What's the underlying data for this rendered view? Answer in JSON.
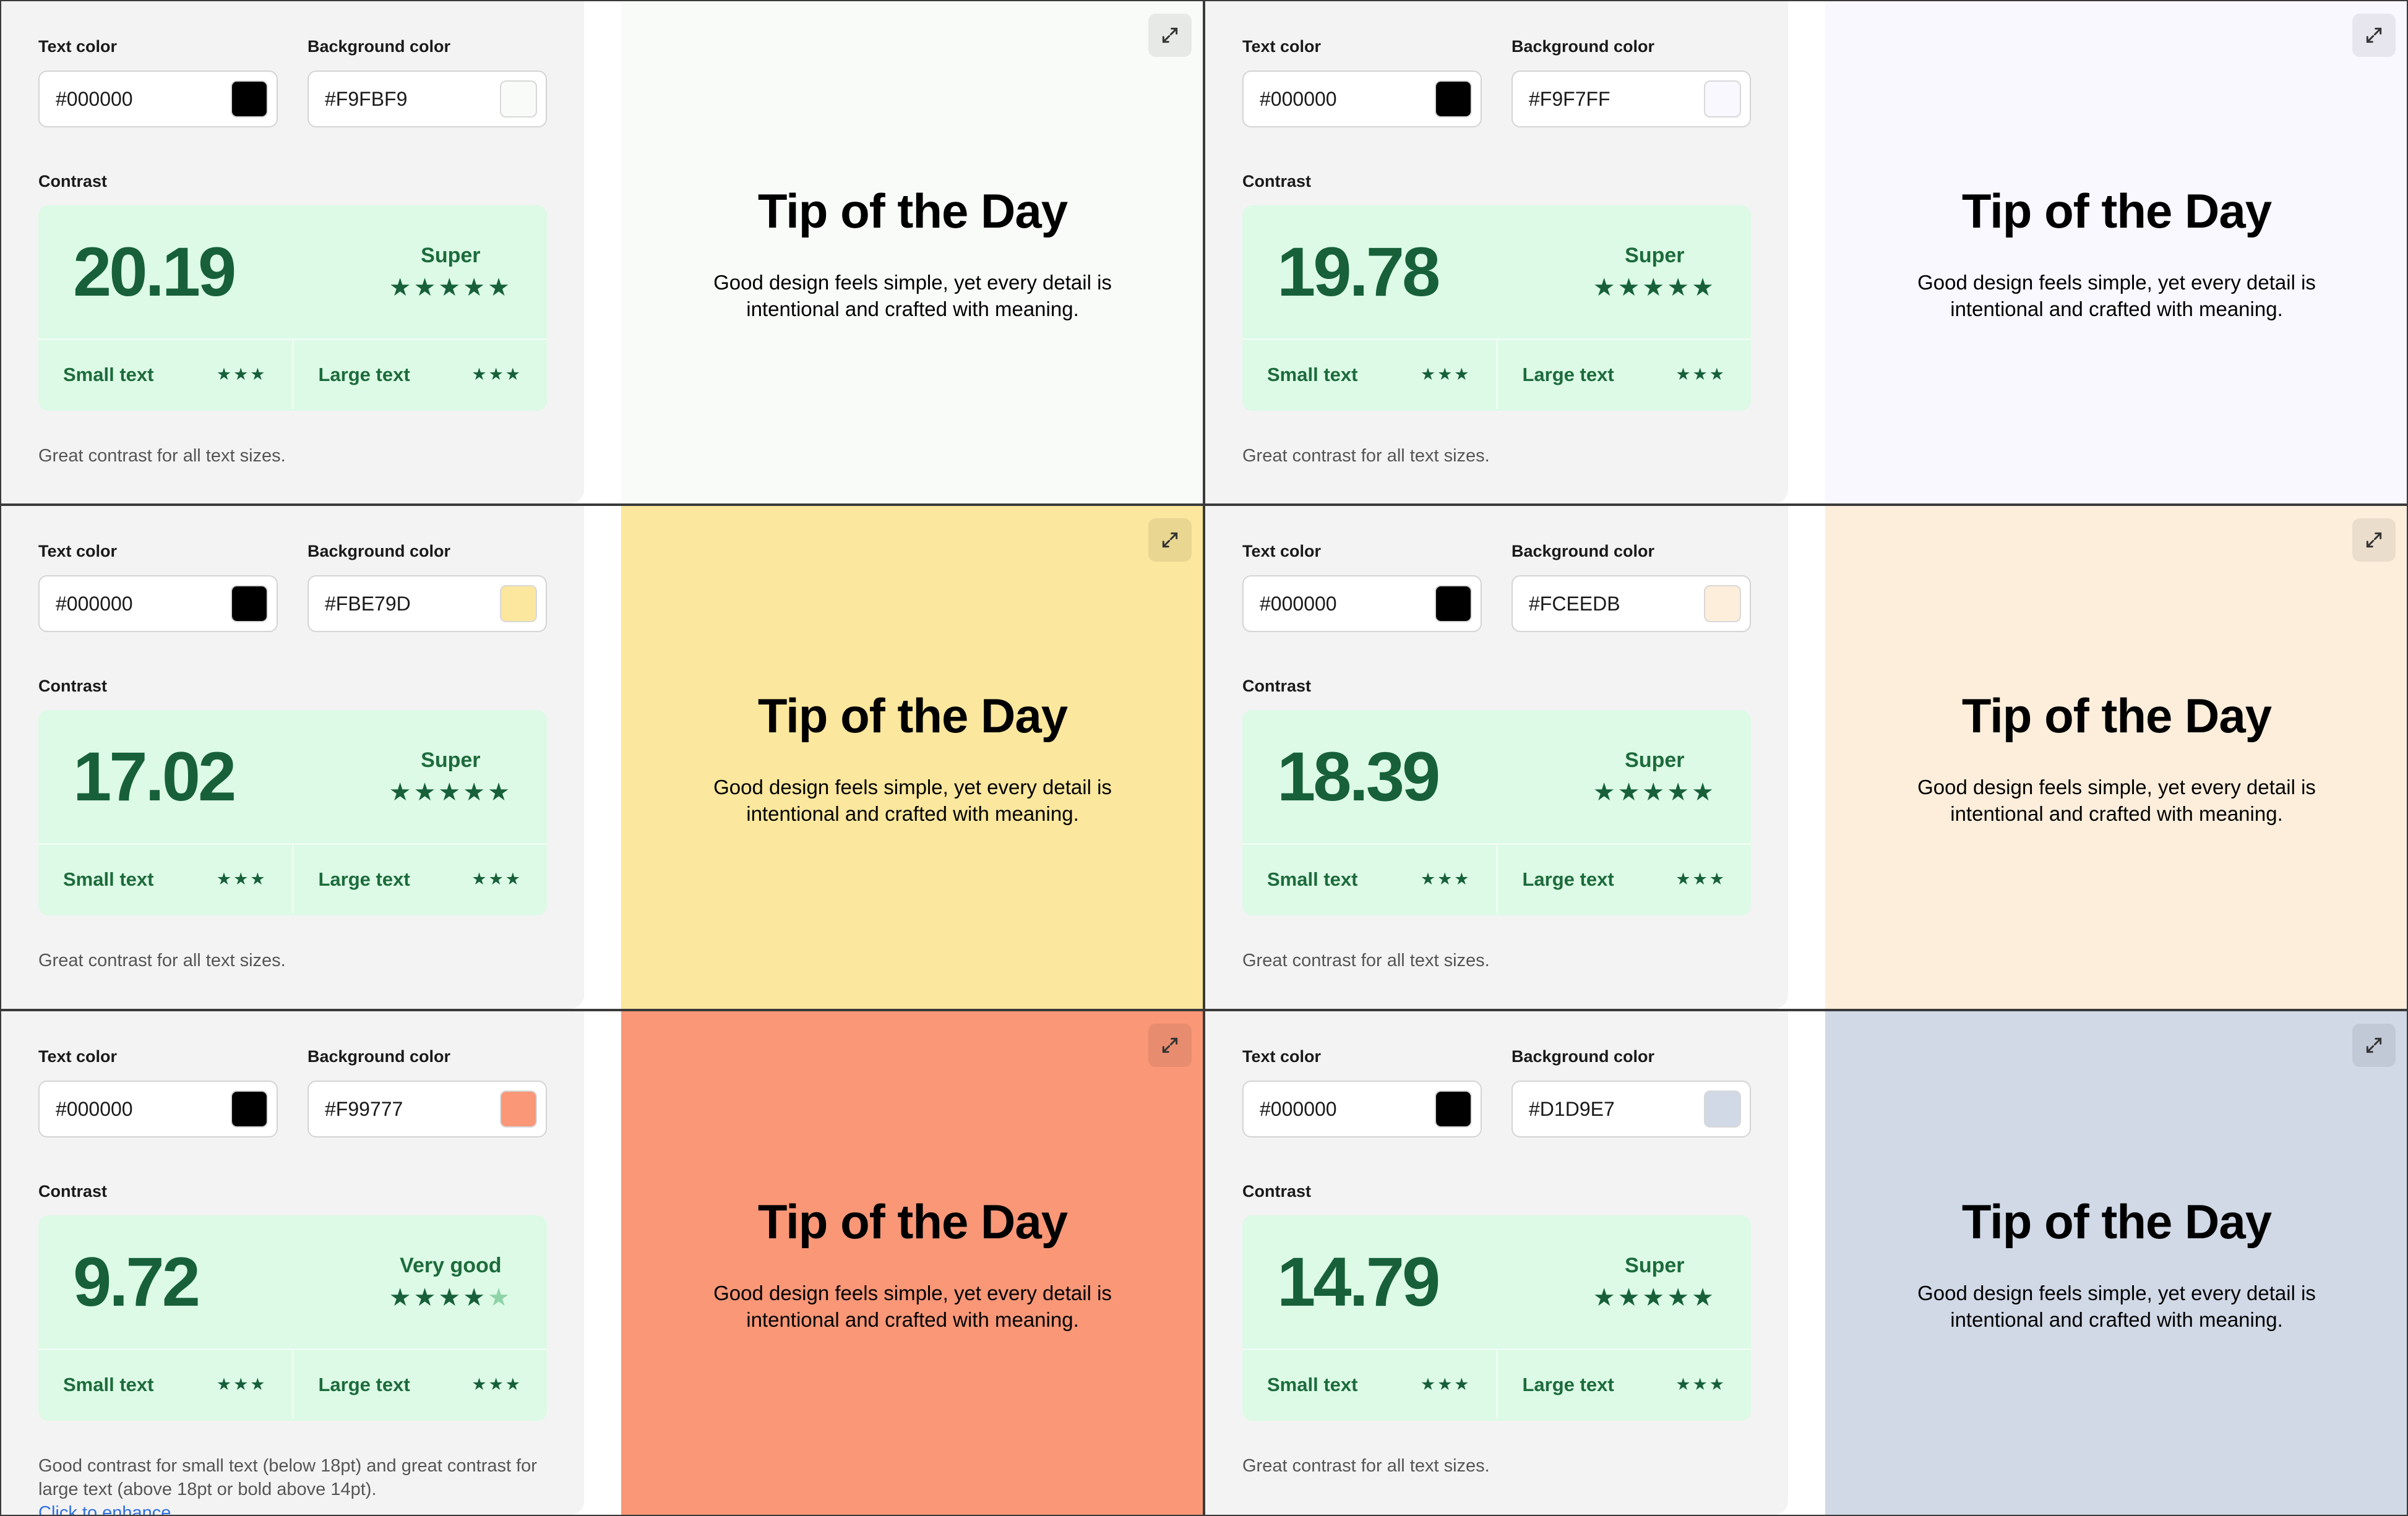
{
  "labels": {
    "text_color": "Text color",
    "background_color": "Background color",
    "contrast": "Contrast",
    "small_text": "Small text",
    "large_text": "Large text"
  },
  "cards": [
    {
      "text_color": "#000000",
      "background_color": "#F9FBF9",
      "contrast_score": "20.19",
      "rating_label": "Super",
      "stars_filled": 5,
      "small_text_stars": 3,
      "large_text_stars": 3,
      "note": "Great contrast for all text sizes.",
      "link": "",
      "preview": {
        "title": "Tip of the Day",
        "body": "Good design feels simple, yet every detail is intentional and crafted with meaning."
      }
    },
    {
      "text_color": "#000000",
      "background_color": "#F9F7FF",
      "contrast_score": "19.78",
      "rating_label": "Super",
      "stars_filled": 5,
      "small_text_stars": 3,
      "large_text_stars": 3,
      "note": "Great contrast for all text sizes.",
      "link": "",
      "preview": {
        "title": "Tip of the Day",
        "body": "Good design feels simple, yet every detail is intentional and crafted with meaning."
      }
    },
    {
      "text_color": "#000000",
      "background_color": "#FBE79D",
      "contrast_score": "17.02",
      "rating_label": "Super",
      "stars_filled": 5,
      "small_text_stars": 3,
      "large_text_stars": 3,
      "note": "Great contrast for all text sizes.",
      "link": "",
      "preview": {
        "title": "Tip of the Day",
        "body": "Good design feels simple, yet every detail is intentional and crafted with meaning."
      }
    },
    {
      "text_color": "#000000",
      "background_color": "#FCEEDB",
      "contrast_score": "18.39",
      "rating_label": "Super",
      "stars_filled": 5,
      "small_text_stars": 3,
      "large_text_stars": 3,
      "note": "Great contrast for all text sizes.",
      "link": "",
      "preview": {
        "title": "Tip of the Day",
        "body": "Good design feels simple, yet every detail is intentional and crafted with meaning."
      }
    },
    {
      "text_color": "#000000",
      "background_color": "#F99777",
      "contrast_score": "9.72",
      "rating_label": "Very good",
      "stars_filled": 4,
      "small_text_stars": 3,
      "large_text_stars": 3,
      "note": "Good contrast for small text (below 18pt) and great contrast for large text (above 18pt or bold above 14pt).",
      "link": "Click to enhance",
      "preview": {
        "title": "Tip of the Day",
        "body": "Good design feels simple, yet every detail is intentional and crafted with meaning."
      }
    },
    {
      "text_color": "#000000",
      "background_color": "#D1D9E7",
      "contrast_score": "14.79",
      "rating_label": "Super",
      "stars_filled": 5,
      "small_text_stars": 3,
      "large_text_stars": 3,
      "note": "Great contrast for all text sizes.",
      "link": "",
      "preview": {
        "title": "Tip of the Day",
        "body": "Good design feels simple, yet every detail is intentional and crafted with meaning."
      }
    }
  ],
  "icons": {
    "expand": "expand-icon",
    "star": "star-icon"
  },
  "colors": {
    "panel_bg": "#F3F3F3",
    "contrast_box_bg": "#DCFAE6",
    "score_green": "#17603A",
    "link_blue": "#2F6FE0"
  }
}
